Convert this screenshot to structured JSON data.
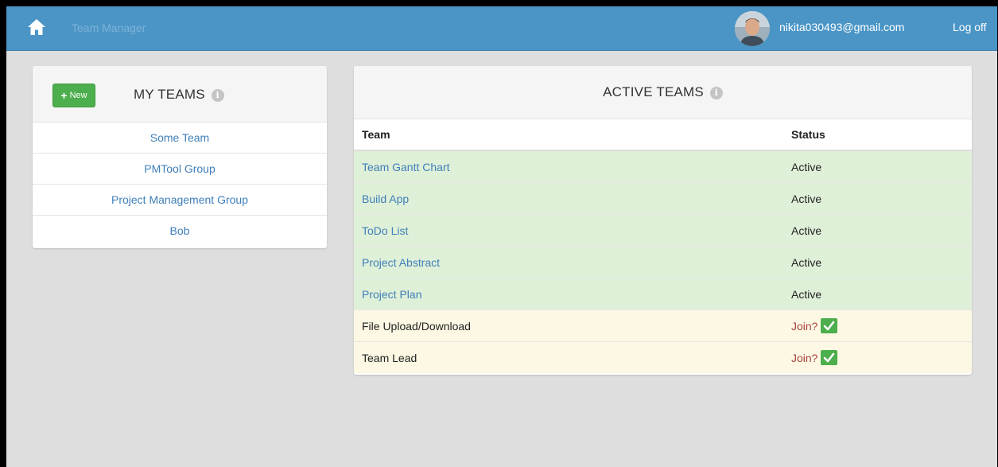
{
  "navbar": {
    "brand": "Team Manager",
    "user_email": "nikita030493@gmail.com",
    "logoff_label": "Log off"
  },
  "my_teams": {
    "title": "MY TEAMS",
    "new_label": "New",
    "items": [
      {
        "label": "Some Team"
      },
      {
        "label": "PMTool Group"
      },
      {
        "label": "Project Management Group"
      },
      {
        "label": "Bob"
      }
    ]
  },
  "active_teams": {
    "title": "ACTIVE TEAMS",
    "columns": [
      "Team",
      "Status"
    ],
    "rows": [
      {
        "team": "Team Gantt Chart",
        "status": "Active"
      },
      {
        "team": "Build App",
        "status": "Active"
      },
      {
        "team": "ToDo List",
        "status": "Active"
      },
      {
        "team": "Project Abstract",
        "status": "Active"
      },
      {
        "team": "Project Plan",
        "status": "Active"
      },
      {
        "team": "File Upload/Download",
        "status": "Join?"
      },
      {
        "team": "Team Lead",
        "status": "Join?"
      }
    ]
  },
  "colors": {
    "navbar": "#4a95c6",
    "success": "#4cae4c",
    "active_row": "#dff0d8",
    "join_row": "#fcf8e3",
    "link": "#3f7fb9",
    "join_text": "#a94442"
  },
  "icons": {
    "home": "home-icon",
    "info": "info-icon",
    "plus": "plus-icon",
    "check": "check-icon"
  }
}
